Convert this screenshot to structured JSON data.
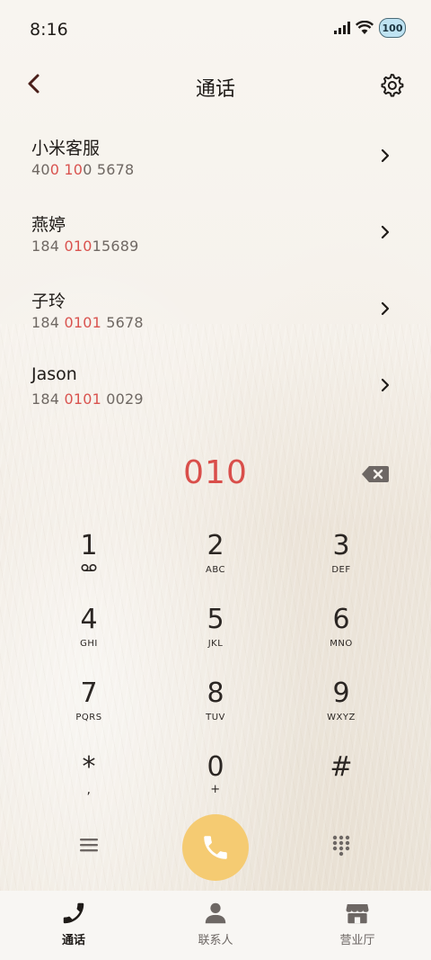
{
  "status_bar": {
    "time": "8:16",
    "battery": "100"
  },
  "header": {
    "title": "通话"
  },
  "results": [
    {
      "name": "小米客服",
      "number_parts": [
        "40",
        "0 10",
        "0 5678"
      ]
    },
    {
      "name": "燕婷",
      "number_parts": [
        "184 ",
        "010",
        "15689"
      ]
    },
    {
      "name": "子玲",
      "number_parts": [
        "184 ",
        "0101",
        " 5678"
      ]
    },
    {
      "name": "Jason",
      "number_parts": [
        "184 ",
        "0101",
        " 0029"
      ]
    }
  ],
  "dial_input": "010",
  "keypad": [
    {
      "digit": "1",
      "letters": ""
    },
    {
      "digit": "2",
      "letters": "ABC"
    },
    {
      "digit": "3",
      "letters": "DEF"
    },
    {
      "digit": "4",
      "letters": "GHI"
    },
    {
      "digit": "5",
      "letters": "JKL"
    },
    {
      "digit": "6",
      "letters": "MNO"
    },
    {
      "digit": "7",
      "letters": "PQRS"
    },
    {
      "digit": "8",
      "letters": "TUV"
    },
    {
      "digit": "9",
      "letters": "WXYZ"
    },
    {
      "digit": "*",
      "letters": ","
    },
    {
      "digit": "0",
      "letters": "+"
    },
    {
      "digit": "#",
      "letters": ""
    }
  ],
  "bottom_nav": [
    {
      "label": "通话",
      "icon": "phone-icon",
      "active": true
    },
    {
      "label": "联系人",
      "icon": "person-icon",
      "active": false
    },
    {
      "label": "营业厅",
      "icon": "store-icon",
      "active": false
    }
  ],
  "colors": {
    "highlight": "#d9534f",
    "call_button": "#f5cb72",
    "background": "#f6f2ec"
  },
  "icons": {
    "voicemail": "voicemail-icon",
    "backspace": "backspace-icon",
    "menu": "menu-icon",
    "dialpad": "dialpad-icon",
    "settings": "gear-icon",
    "back": "back-icon"
  }
}
